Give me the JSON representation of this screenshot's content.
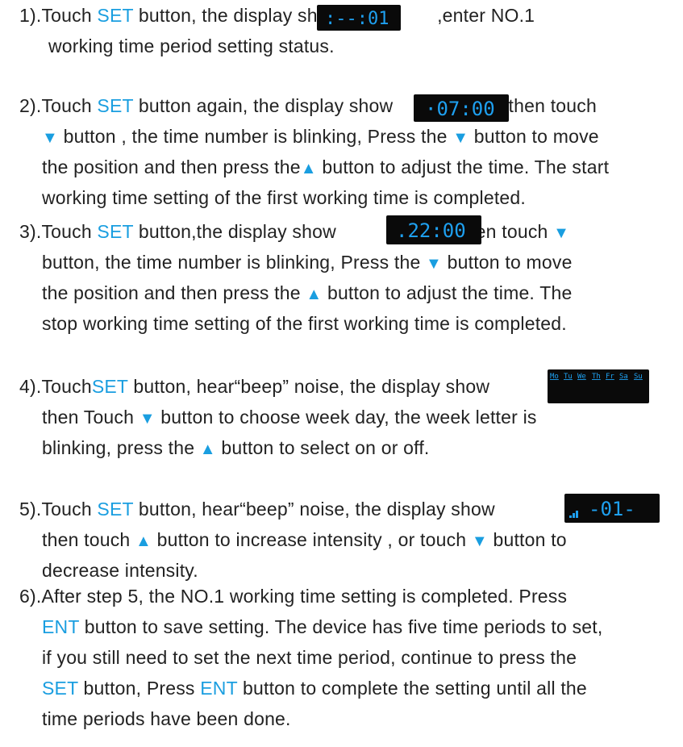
{
  "colors": {
    "accent": "#1a9ee0",
    "lcd_bg": "#0a0a0a",
    "lcd_digit": "#1ea0f0",
    "text": "#222222"
  },
  "steps": [
    {
      "lines": [
        [
          "1).Touch ",
          "SET",
          " button, the display show",
          "",
          " ,enter NO.1"
        ],
        [
          "working time period setting status."
        ]
      ],
      "display": ":--:01"
    },
    {
      "lines": [
        [
          "2).Touch ",
          "SET",
          " button again, the display show",
          "",
          " ,then touch"
        ],
        [
          "▼",
          " button , the time number is blinking, Press the ",
          "▼",
          " button to move"
        ],
        [
          "the position and then press the",
          "▲",
          " button to adjust the time. The start"
        ],
        [
          "working time setting of the first working time is completed."
        ]
      ],
      "display": "·07:00"
    },
    {
      "lines": [
        [
          "3).Touch ",
          "SET",
          " button,the display show",
          "",
          " ,then touch ",
          "▼"
        ],
        [
          "button, the time number is blinking, Press the ",
          "▼",
          " button to move"
        ],
        [
          "the position and then press the ",
          "▲",
          " button to adjust the time. The"
        ],
        [
          "stop working time setting of the first working time is completed."
        ]
      ],
      "display": ".22:00"
    },
    {
      "lines": [
        [
          "4).Touch",
          "SET",
          " button, hear“beep” noise, the display show"
        ],
        [
          "then Touch ",
          "▼",
          " button to choose week day,  the week letter is"
        ],
        [
          "blinking, press the ",
          "▲",
          " button to select on or off."
        ]
      ],
      "display_days": [
        "Mo",
        "Tu",
        "We",
        "Th",
        "Fr",
        "Sa",
        "Su"
      ]
    },
    {
      "lines": [
        [
          "5).Touch ",
          "SET",
          " button, hear“beep” noise, the display show"
        ],
        [
          "then touch ",
          "▲",
          " button to increase intensity , or touch ",
          "▼",
          " button to"
        ],
        [
          "decrease intensity."
        ]
      ],
      "display": "-01-"
    },
    {
      "lines": [
        [
          "6).After step 5, the NO.1 working time setting is completed. Press"
        ],
        [
          "ENT",
          " button to save setting. The device has five time periods to set,"
        ],
        [
          "if you still need to set the next time period, continue to press the"
        ],
        [
          "SET",
          " button, Press ",
          "ENT",
          " button to complete the setting until all the"
        ],
        [
          "time periods have been done."
        ]
      ]
    }
  ]
}
